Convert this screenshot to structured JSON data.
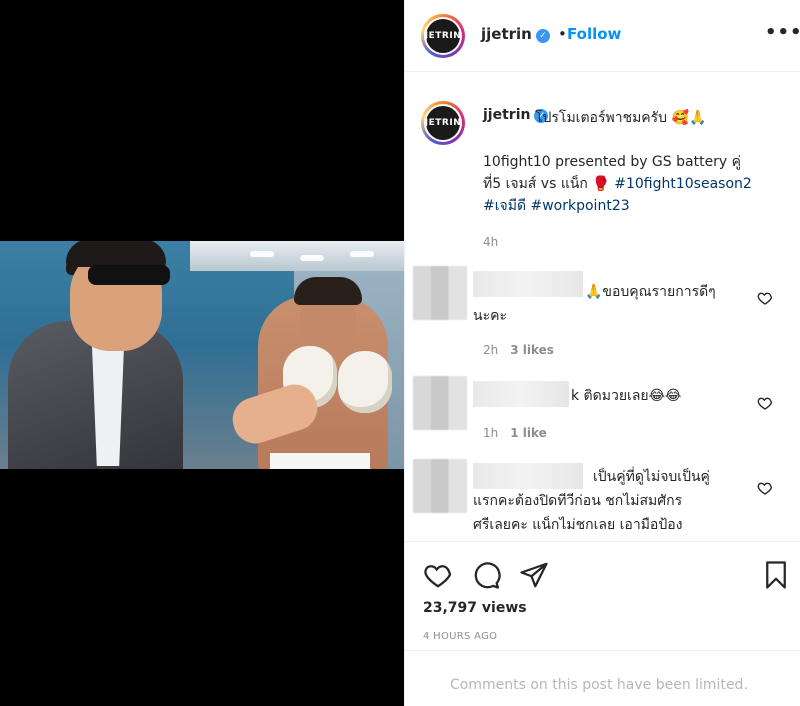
{
  "header": {
    "username": "jjetrin",
    "avatar_text": "JETRIN",
    "dot": "•",
    "follow_label": "Follow",
    "more_label": "•••"
  },
  "caption": {
    "username": "jjetrin",
    "headline": "โปรโมเตอร์พาชมครับ 🥰🙏",
    "line1": "10fight10 presented by GS battery คู่",
    "line2_text": "ที่5 เจมส์ vs แน็ก 🥊 ",
    "line2_tag": "#10fight10season2",
    "line3_tag1": "#เจมีดี",
    "line3_tag2": "#workpoint23",
    "time": "4h"
  },
  "comments": [
    {
      "text_line1": "🙏ขอบคุณรายการดีๆ",
      "text_line2": "นะคะ",
      "time": "2h",
      "likes": "3 likes"
    },
    {
      "text_line1": "k ติดมวยเลย😂😂",
      "time": "1h",
      "likes": "1 like"
    },
    {
      "text_line1": "เป็นคู่ที่ดูไม่จบเป็นคู่",
      "text_line2": "แรกคะต้องปิดทีวีก่อน ชกไม่สมศักร",
      "text_line3": "ศรีเลยคะ แน็กไม่ชกเลย เอามือป้อง"
    }
  ],
  "stats": {
    "views": "23,797 views",
    "ago": "4 HOURS AGO"
  },
  "footer": {
    "limited_text": "Comments on this post have been limited."
  },
  "icons": {
    "heart": "heart-icon",
    "comment": "comment-icon",
    "share": "share-icon",
    "save": "bookmark-icon"
  }
}
